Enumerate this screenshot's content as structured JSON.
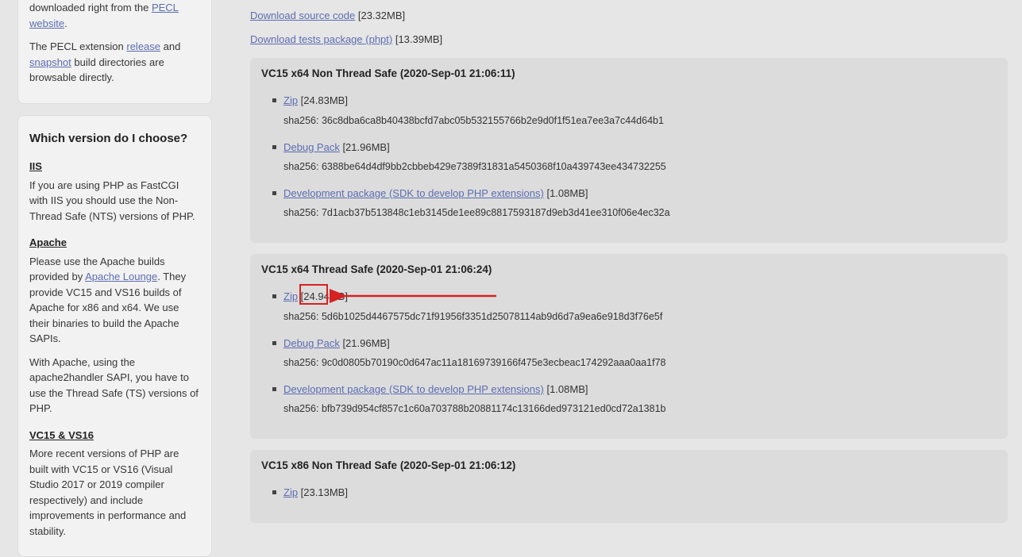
{
  "sidebar": {
    "panel1": {
      "p1_pre": "downloaded right from the ",
      "p1_link": "PECL website",
      "p1_post": ".",
      "p2_pre": "The PECL extension ",
      "p2_link1": "release",
      "p2_mid": " and ",
      "p2_link2": "snapshot",
      "p2_post": " build directories are browsable directly."
    },
    "panel2": {
      "heading": "Which version do I choose?",
      "iis_h": "IIS",
      "iis_p": "If you are using PHP as FastCGI with IIS you should use the Non-Thread Safe (NTS) versions of PHP.",
      "apache_h": "Apache",
      "apache_p1_pre": "Please use the Apache builds provided by ",
      "apache_p1_link": "Apache Lounge",
      "apache_p1_post": ". They provide VC15 and VS16 builds of Apache for x86 and x64. We use their binaries to build the Apache SAPIs.",
      "apache_p2": "With Apache, using the apache2handler SAPI, you have to use the Thread Safe (TS) versions of PHP.",
      "vc_h": "VC15 & VS16",
      "vc_p": "More recent versions of PHP are built with VC15 or VS16 (Visual Studio 2017 or 2019 compiler respectively) and include improvements in performance and stability."
    }
  },
  "main": {
    "source": {
      "label": "Download source code",
      "size": "[23.32MB]"
    },
    "tests": {
      "label": "Download tests package (phpt)",
      "size": "[13.39MB]"
    },
    "builds": [
      {
        "title": "VC15 x64 Non Thread Safe (2020-Sep-01 21:06:11)",
        "items": [
          {
            "label": "Zip",
            "size": "[24.83MB]",
            "sha": "sha256: 36c8dba6ca8b40438bcfd7abc05b532155766b2e9d0f1f51ea7ee3a7c44d64b1"
          },
          {
            "label": "Debug Pack",
            "size": "[21.96MB]",
            "sha": "sha256: 6388be64d4df9bb2cbbeb429e7389f31831a5450368f10a439743ee434732255"
          },
          {
            "label": "Development package (SDK to develop PHP extensions)",
            "size": "[1.08MB]",
            "sha": "sha256: 7d1acb37b513848c1eb3145de1ee89c8817593187d9eb3d41ee310f06e4ec32a"
          }
        ]
      },
      {
        "title": "VC15 x64 Thread Safe (2020-Sep-01 21:06:24)",
        "items": [
          {
            "label": "Zip",
            "size": "[24.94MB]",
            "sha": "sha256: 5d6b1025d4467575dc71f91956f3351d25078114ab9d6d7a9ea6e918d3f76e5f"
          },
          {
            "label": "Debug Pack",
            "size": "[21.96MB]",
            "sha": "sha256: 9c0d0805b70190c0d647ac11a18169739166f475e3ecbeac174292aaa0aa1f78"
          },
          {
            "label": "Development package (SDK to develop PHP extensions)",
            "size": "[1.08MB]",
            "sha": "sha256: bfb739d954cf857c1c60a703788b20881174c13166ded973121ed0cd72a1381b"
          }
        ]
      },
      {
        "title": "VC15 x86 Non Thread Safe (2020-Sep-01 21:06:12)",
        "items": [
          {
            "label": "Zip",
            "size": "[23.13MB]",
            "sha": ""
          }
        ]
      }
    ]
  }
}
